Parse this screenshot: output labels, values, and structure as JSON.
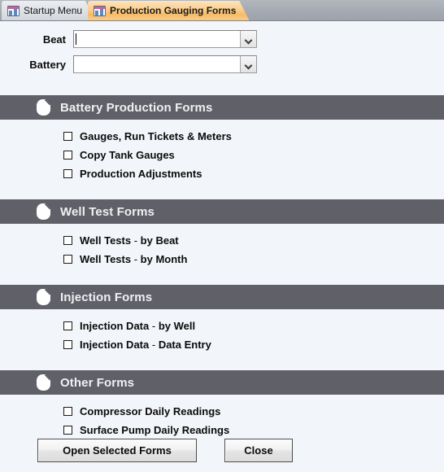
{
  "window": {
    "tabs": [
      {
        "label": "Startup Menu",
        "icon": "form-window-icon",
        "active": false
      },
      {
        "label": "Production Gauging Forms",
        "icon": "form-window-icon",
        "active": true
      }
    ]
  },
  "filters": [
    {
      "label": "Beat",
      "value": "",
      "placeholder": "",
      "icon": "chevron-down-icon",
      "focused": true
    },
    {
      "label": "Battery",
      "value": "",
      "placeholder": "",
      "icon": "chevron-down-icon",
      "focused": false
    }
  ],
  "sections": [
    {
      "title": "Battery Production Forms",
      "icon": "page-curl-icon",
      "options": [
        {
          "label": "Gauges, Run Tickets & Meters",
          "checked": false
        },
        {
          "label": "Copy Tank Gauges",
          "checked": false
        },
        {
          "label": "Production Adjustments",
          "checked": false
        }
      ]
    },
    {
      "title": "Well Test Forms",
      "icon": "page-curl-icon",
      "options": [
        {
          "label": "Well Tests - by Beat",
          "checked": false
        },
        {
          "label": "Well Tests - by Month",
          "checked": false
        }
      ]
    },
    {
      "title": "Injection Forms",
      "icon": "page-curl-icon",
      "options": [
        {
          "label": "Injection Data - by Well",
          "checked": false
        },
        {
          "label": "Injection Data - Data Entry",
          "checked": false
        }
      ]
    },
    {
      "title": "Other Forms",
      "icon": "page-curl-icon",
      "options": [
        {
          "label": "Compressor Daily Readings",
          "checked": false
        },
        {
          "label": "Surface Pump Daily Readings",
          "checked": false
        }
      ]
    }
  ],
  "footer": {
    "open_label": "Open Selected Forms",
    "close_label": "Close"
  },
  "colors": {
    "section_header_bg": "#5f6068",
    "page_bg": "#f2f5f9",
    "active_tab": "#f6bb66",
    "inactive_tab": "#dfe2e6",
    "tabstrip_bg": "#a5a9b1"
  }
}
